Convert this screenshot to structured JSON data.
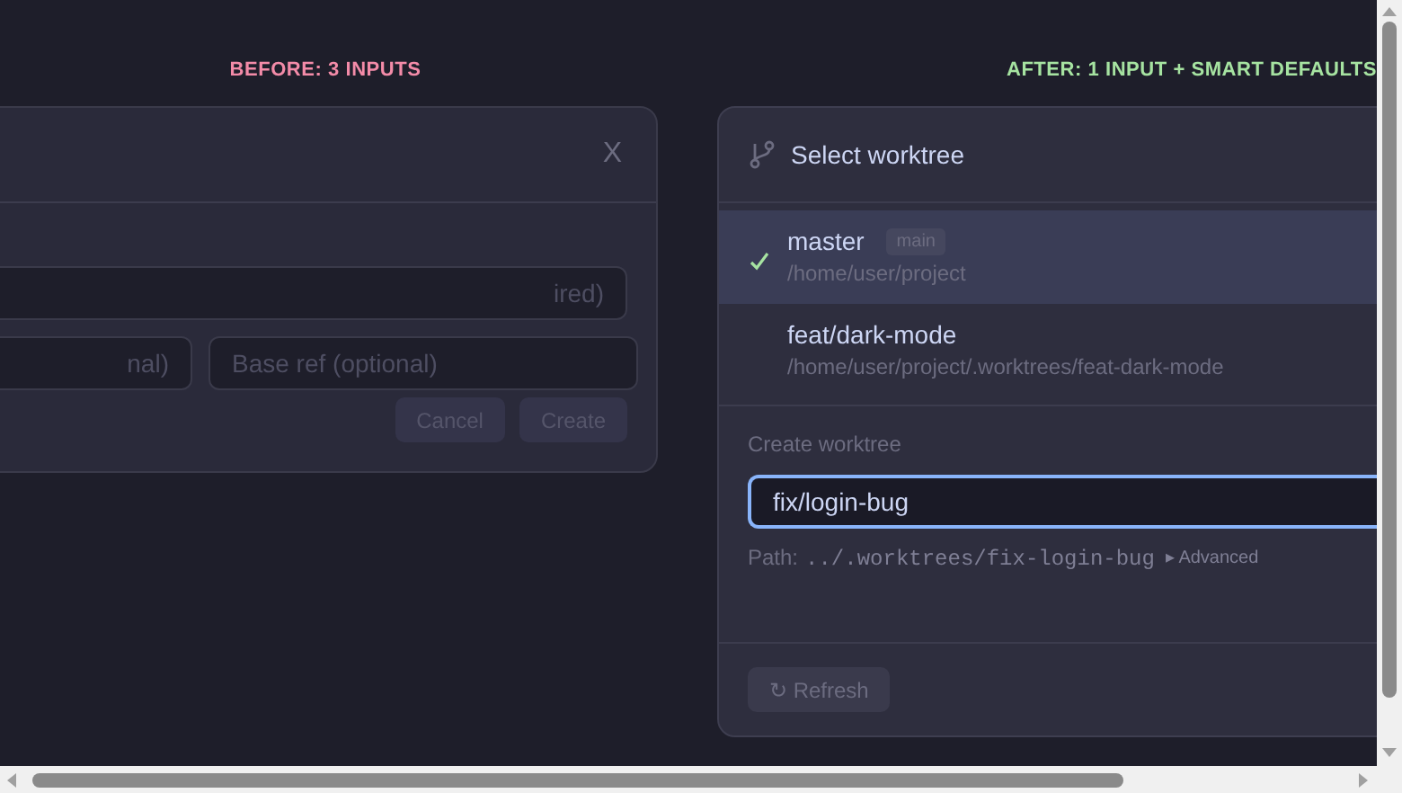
{
  "before": {
    "heading": "BEFORE: 3 INPUTS",
    "close": "X",
    "fields": [
      {
        "placeholder": "ired)"
      },
      {
        "placeholder": "nal)"
      },
      {
        "placeholder": "Base ref (optional)"
      }
    ],
    "buttons": [
      {
        "label": "Cancel",
        "disabled": true
      },
      {
        "label": "Create",
        "disabled": true
      }
    ]
  },
  "after": {
    "heading": "AFTER: 1 INPUT + SMART DEFAULTS",
    "title": "Select worktree",
    "worktrees": [
      {
        "name": "master",
        "badge": "main",
        "path": "/home/user/project",
        "selected": true
      },
      {
        "name": "feat/dark-mode",
        "path": "/home/user/project/.worktrees/feat-dark-mode",
        "selected": false
      }
    ],
    "create_label": "Create worktree",
    "input_value": "fix/login-bug",
    "path_label": "Path:",
    "path_value": "../.worktrees/fix-login-bug",
    "advanced": "▸ Advanced",
    "refresh": "↻ Refresh"
  }
}
